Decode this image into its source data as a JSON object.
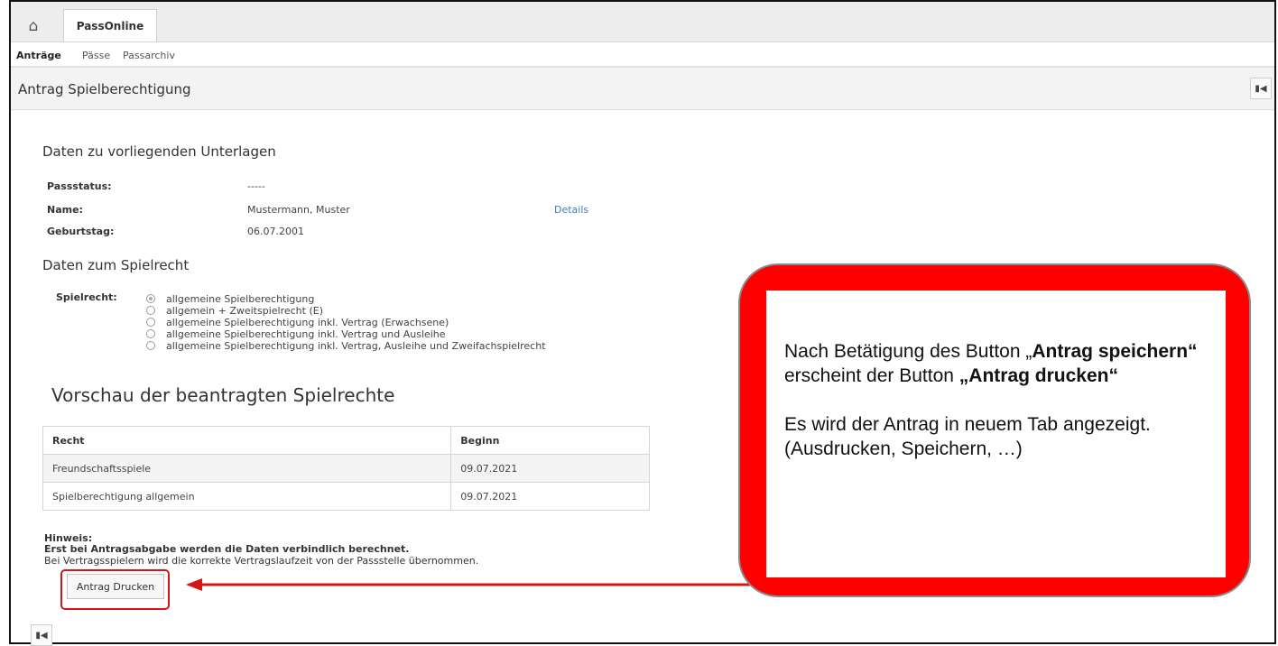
{
  "topbar": {
    "home_icon": "home-icon",
    "app_tab": "PassOnline"
  },
  "subnav": {
    "items": [
      "Anträge",
      "Pässe",
      "Passarchiv"
    ]
  },
  "page": {
    "title": "Antrag Spielberechtigung",
    "collapse_icon": "first-page-icon"
  },
  "documents": {
    "heading": "Daten zu vorliegenden Unterlagen",
    "fields": [
      {
        "label": "Passstatus:",
        "value": "-----"
      },
      {
        "label": "Name:",
        "value": "Mustermann, Muster",
        "link": "Details"
      },
      {
        "label": "Geburtstag:",
        "value": "06.07.2001"
      }
    ]
  },
  "playing_rights": {
    "heading": "Daten zum Spielrecht",
    "label": "Spielrecht:",
    "selected_index": 0,
    "options": [
      "allgemeine Spielberechtigung",
      "allgemein + Zweitspielrecht (E)",
      "allgemeine Spielberechtigung inkl. Vertrag (Erwachsene)",
      "allgemeine Spielberechtigung inkl. Vertrag und Ausleihe",
      "allgemeine Spielberechtigung inkl. Vertrag, Ausleihe und Zweifachspielrecht"
    ]
  },
  "preview": {
    "heading": "Vorschau der beantragten Spielrechte",
    "columns": [
      "Recht",
      "Beginn"
    ],
    "rows": [
      [
        "Freundschaftsspiele",
        "09.07.2021"
      ],
      [
        "Spielberechtigung allgemein",
        "09.07.2021"
      ]
    ]
  },
  "notice": {
    "title": "Hinweis:",
    "bold_line": "Erst bei Antragsabgabe werden die Daten verbindlich berechnet.",
    "line": "Bei Vertragsspielern wird die korrekte Vertragslaufzeit von der Passstelle übernommen."
  },
  "print_button": "Antrag Drucken",
  "callout": {
    "p1_a": "Nach Betätigung des Button „",
    "p1_b": "Antrag speichern“",
    "p1_c": " erscheint der Button ",
    "p1_d": "„Antrag drucken“",
    "p2": "Es wird der Antrag in neuem Tab angezeigt.",
    "p3": "(Ausdrucken, Speichern, …)"
  },
  "colors": {
    "callout_red": "#ff0000",
    "link_blue": "#4a7cb8",
    "arrow_red": "#d61515"
  }
}
